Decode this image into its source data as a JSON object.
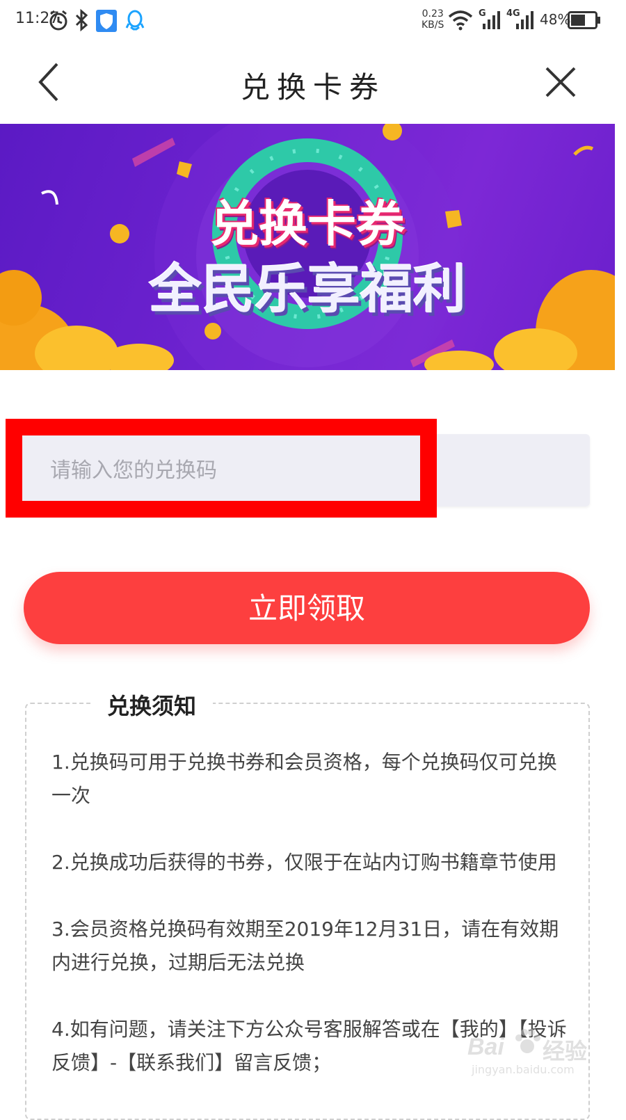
{
  "status_bar": {
    "time": "11:27",
    "net_speed": "0.23",
    "net_unit": "KB/S",
    "sim1": "G",
    "sim2": "4G",
    "battery": "48%"
  },
  "header": {
    "title": "兑换卡券"
  },
  "banner": {
    "line1": "兑换卡券",
    "line2": "全民乐享福利"
  },
  "form": {
    "placeholder": "请输入您的兑换码",
    "submit_label": "立即领取"
  },
  "notice": {
    "title": "兑换须知",
    "items": [
      "1.兑换码可用于兑换书券和会员资格，每个兑换码仅可兑换一次",
      "2.兑换成功后获得的书券，仅限于在站内订购书籍章节使用",
      "3.会员资格兑换码有效期至2019年12月31日，请在有效期内进行兑换，过期后无法兑换",
      "4.如有问题，请关注下方公众号客服解答或在【我的】【投诉反馈】-【联系我们】留言反馈；"
    ]
  },
  "watermark": {
    "brand": "Bai",
    "brand2": "经验",
    "url": "jingyan.baidu.com"
  },
  "colors": {
    "accent": "#fd3f3f",
    "annotation": "#ff0000",
    "banner_bg": "#6a1fcc",
    "input_bg": "#eeeef5"
  }
}
